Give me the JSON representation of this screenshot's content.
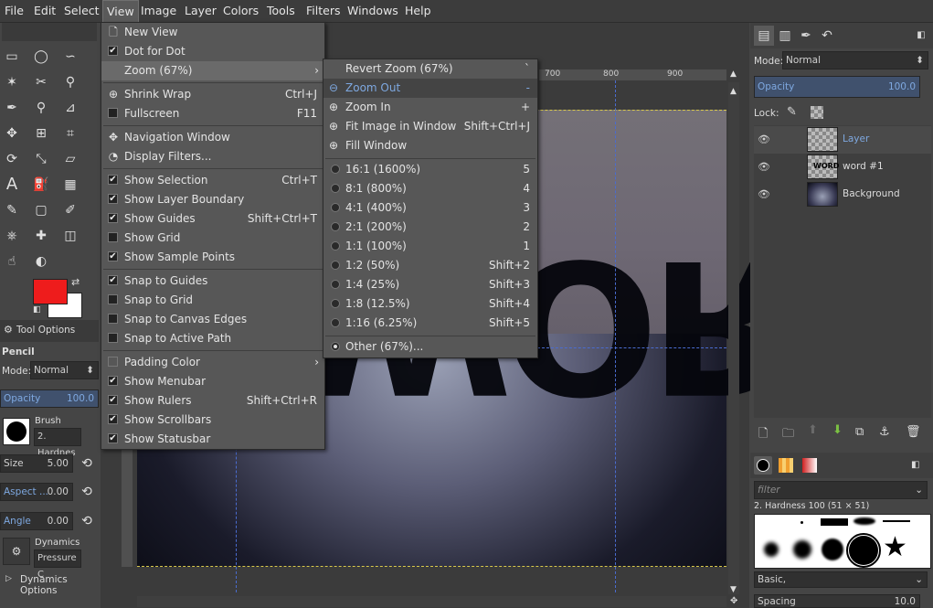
{
  "menubar": {
    "items": [
      "File",
      "Edit",
      "Select",
      "View",
      "Image",
      "Layer",
      "Colors",
      "Tools",
      "Filters",
      "Windows",
      "Help"
    ]
  },
  "view_menu": {
    "new_view": "New View",
    "dot_for_dot": "Dot for Dot",
    "zoom": "Zoom (67%)",
    "shrink_wrap": "Shrink Wrap",
    "shrink_wrap_sc": "Ctrl+J",
    "fullscreen": "Fullscreen",
    "fullscreen_sc": "F11",
    "navigation_window": "Navigation Window",
    "display_filters": "Display Filters...",
    "show_selection": "Show Selection",
    "show_selection_sc": "Ctrl+T",
    "show_layer_boundary": "Show Layer Boundary",
    "show_guides": "Show Guides",
    "show_guides_sc": "Shift+Ctrl+T",
    "show_grid": "Show Grid",
    "show_sample_points": "Show Sample Points",
    "snap_to_guides": "Snap to Guides",
    "snap_to_grid": "Snap to Grid",
    "snap_to_canvas_edges": "Snap to Canvas Edges",
    "snap_to_active_path": "Snap to Active Path",
    "padding_color": "Padding Color",
    "show_menubar": "Show Menubar",
    "show_rulers": "Show Rulers",
    "show_rulers_sc": "Shift+Ctrl+R",
    "show_scrollbars": "Show Scrollbars",
    "show_statusbar": "Show Statusbar",
    "checkmark": "✔"
  },
  "zoom_menu": {
    "revert_zoom": "Revert Zoom (67%)",
    "revert_zoom_sc": "`",
    "zoom_out": "Zoom Out",
    "zoom_out_sc": "-",
    "zoom_in": "Zoom In",
    "zoom_in_sc": "+",
    "fit_image": "Fit Image in Window",
    "fit_image_sc": "Shift+Ctrl+J",
    "fill_window": "Fill Window",
    "levels": [
      {
        "label": "16:1  (1600%)",
        "sc": "5"
      },
      {
        "label": "8:1  (800%)",
        "sc": "4"
      },
      {
        "label": "4:1  (400%)",
        "sc": "3"
      },
      {
        "label": "2:1  (200%)",
        "sc": "2"
      },
      {
        "label": "1:1  (100%)",
        "sc": "1"
      },
      {
        "label": "1:2  (50%)",
        "sc": "Shift+2"
      },
      {
        "label": "1:4  (25%)",
        "sc": "Shift+3"
      },
      {
        "label": "1:8  (12.5%)",
        "sc": "Shift+4"
      },
      {
        "label": "1:16  (6.25%)",
        "sc": "Shift+5"
      }
    ],
    "other": "Other (67%)..."
  },
  "tool_options": {
    "tab_label": "Tool Options",
    "tool_name": "Pencil",
    "mode_label": "Mode:",
    "mode_value": "Normal",
    "opacity_label": "Opacity",
    "opacity_value": "100.0",
    "brush_label": "Brush",
    "brush_value": "2. Hardnes",
    "size_label": "Size",
    "size_value": "5.00",
    "aspect_label": "Aspect ...",
    "aspect_value": "0.00",
    "angle_label": "Angle",
    "angle_value": "0.00",
    "dynamics_label": "Dynamics",
    "dynamics_value": "Pressure C",
    "dynamics_options": "Dynamics Options"
  },
  "canvas": {
    "word": "WORD",
    "ruler_marks": [
      "700",
      "800",
      "900"
    ]
  },
  "layers_panel": {
    "mode_label": "Mode:",
    "mode_value": "Normal",
    "opacity_label": "Opacity",
    "opacity_value": "100.0",
    "lock_label": "Lock:",
    "layers": [
      {
        "name": "Layer",
        "active": true
      },
      {
        "name": "word #1",
        "active": false
      },
      {
        "name": "Background",
        "active": false
      }
    ]
  },
  "brushes_panel": {
    "filter_placeholder": "filter",
    "brush_name": "2. Hardness 100 (51 × 51)",
    "preset": "Basic,",
    "spacing_label": "Spacing",
    "spacing_value": "10.0"
  },
  "colors": {
    "fg": "#ee1c1c",
    "bg": "#ffffff",
    "accent": "#7ea8e0"
  }
}
